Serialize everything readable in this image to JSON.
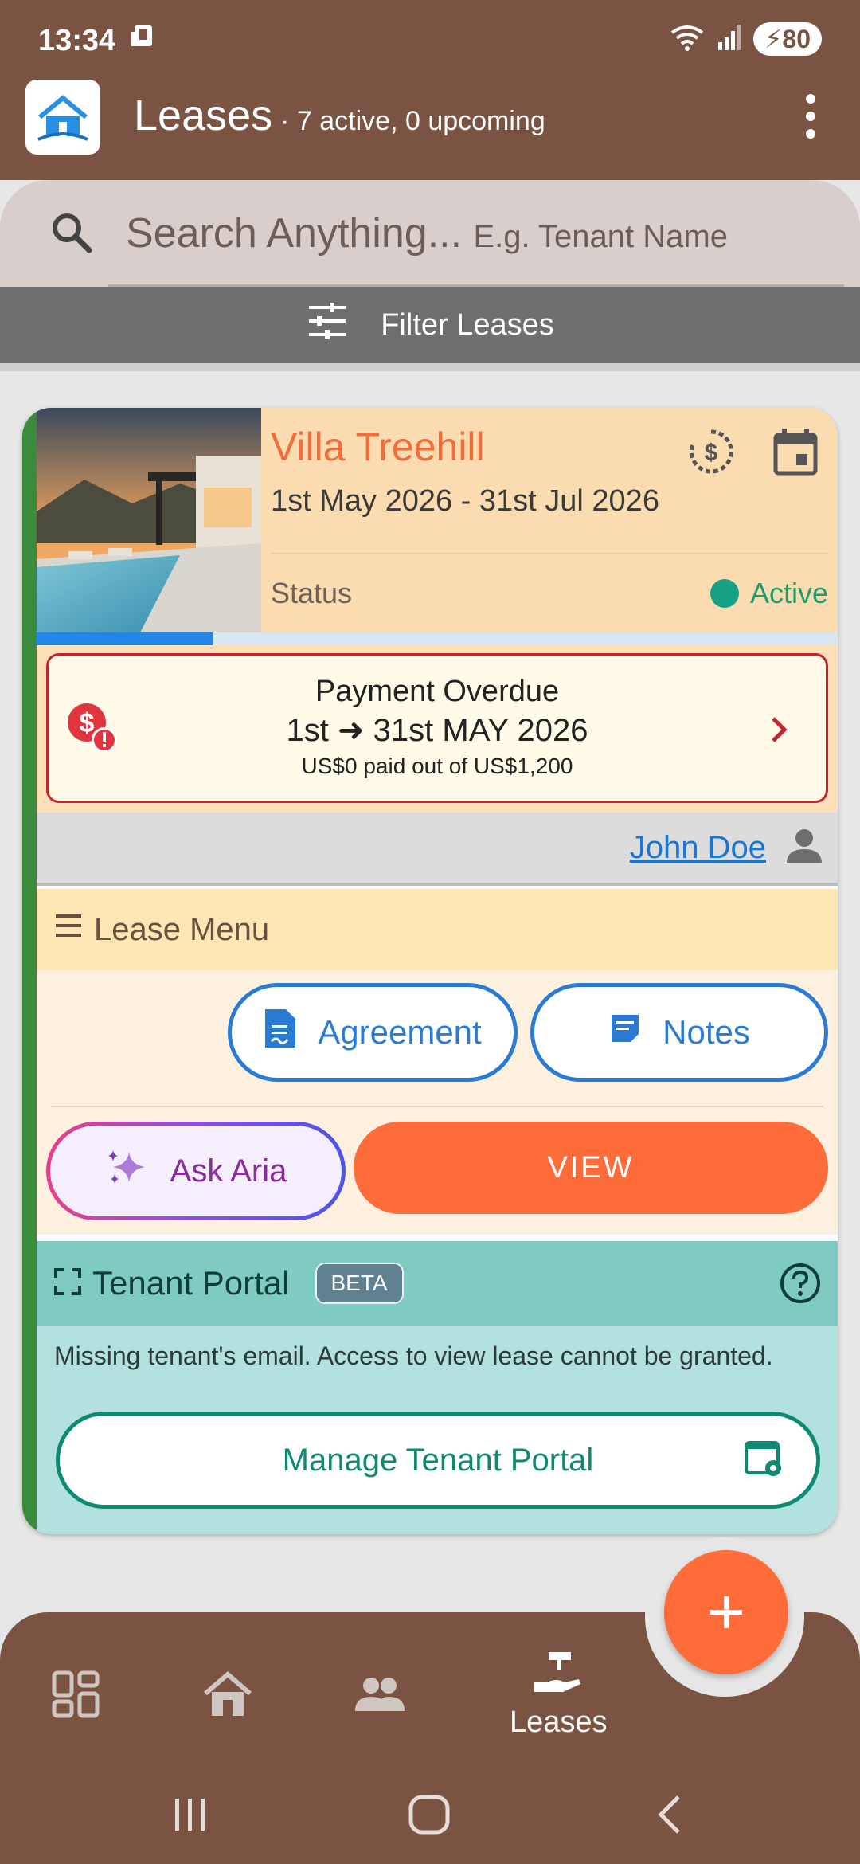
{
  "status_bar": {
    "time": "13:34",
    "battery": "80"
  },
  "app_bar": {
    "title": "Leases",
    "subtitle": "· 7 active, 0 upcoming"
  },
  "search": {
    "placeholder_main": "Search Anything...",
    "placeholder_hint": "E.g. Tenant Name"
  },
  "filter": {
    "label": "Filter Leases"
  },
  "lease_card": {
    "property_name": "Villa Treehill",
    "date_range": "1st May 2026 - 31st Jul 2026",
    "status_label": "Status",
    "status_value": "Active",
    "period_progress": 0.22,
    "payment": {
      "title": "Payment Overdue",
      "period": "1st ➜ 31st MAY 2026",
      "summary": "US$0 paid out of US$1,200"
    },
    "tenant_name": "John Doe",
    "menu": {
      "title": "Lease Menu",
      "agreement_label": "Agreement",
      "notes_label": "Notes",
      "ask_aria_label": "Ask Aria",
      "view_label": "VIEW"
    },
    "portal": {
      "title": "Tenant Portal",
      "badge": "BETA",
      "message": "Missing tenant's email. Access to view lease cannot be granted.",
      "manage_label": "Manage Tenant Portal"
    }
  },
  "bottom_nav": {
    "active_label": "Leases"
  },
  "colors": {
    "brand_brown": "#7a5343",
    "accent_orange": "#fe6c3a",
    "active_green": "#16a085",
    "overdue_red": "#c8222e"
  }
}
